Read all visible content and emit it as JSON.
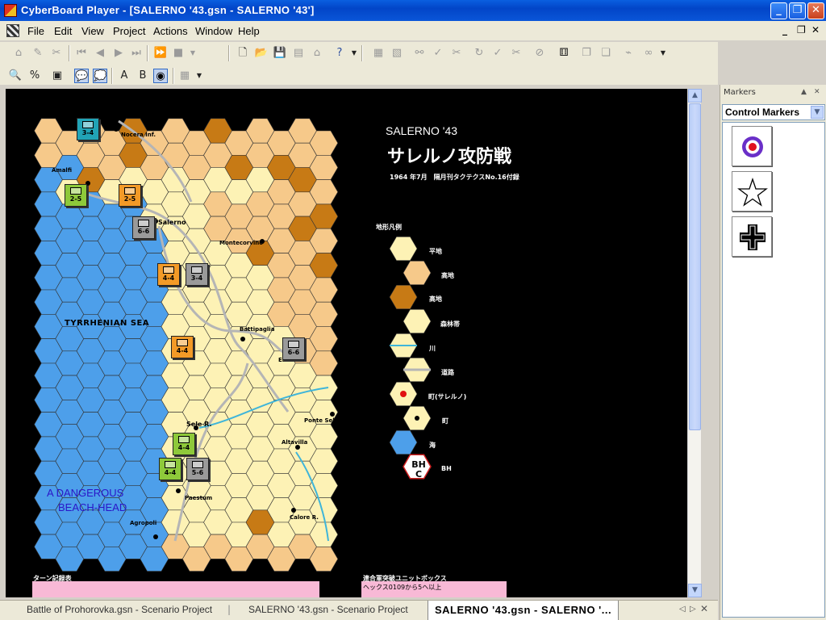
{
  "window": {
    "title": "CyberBoard Player - [SALERNO '43.gsn - SALERNO '43']",
    "min_glyph": "_",
    "max_glyph": "❐",
    "close_glyph": "✕"
  },
  "menu": {
    "items": [
      "File",
      "Edit",
      "View",
      "Project",
      "Actions",
      "Window",
      "Help"
    ],
    "mdi_min": "_",
    "mdi_restore": "❐",
    "mdi_close": "✕"
  },
  "board": {
    "game_title": "SALERNO '43",
    "game_title_jp": "サレルノ攻防戦",
    "subtitle": "1964 年7月　隔月刊タクテクスNo.16付録",
    "legend_title": "地形凡例",
    "legend_items": [
      "平地",
      "高地",
      "高地",
      "森林帯",
      "川",
      "道路",
      "町(サレルノ)",
      "町",
      "海",
      "BH"
    ],
    "legend_bh_line1": "BH",
    "legend_bh_line2": "C",
    "sea_label": "TYRRHENIAN SEA",
    "beach_line1": "A DANGEROUS",
    "beach_line2": "BEACH-HEAD",
    "towns": [
      "Nocera Inf.",
      "Amalfi",
      "Salerno",
      "Montecorvino",
      "Battipaglia",
      "Eboli",
      "Sele R.",
      "Ponte Sele",
      "Altavilla",
      "Paestum",
      "Calore R.",
      "Agropoli"
    ],
    "turn_box_title": "ターン記録表",
    "allied_box_title": "連合軍突破ユニットボックス",
    "allied_box_note": "ヘックス0109から5ヘ以上"
  },
  "units": [
    {
      "label": "3-4",
      "color": "#21a3b6"
    },
    {
      "label": "2-5",
      "color": "#8ec93a"
    },
    {
      "label": "2-5",
      "color": "#f39a27"
    },
    {
      "label": "6-6",
      "color": "#9a9a9a"
    },
    {
      "label": "4-4",
      "color": "#f39a27"
    },
    {
      "label": "3-4",
      "color": "#9a9a9a"
    },
    {
      "label": "4-4",
      "color": "#f39a27"
    },
    {
      "label": "6-6",
      "color": "#9a9a9a"
    },
    {
      "label": "4-4",
      "color": "#8ec93a"
    },
    {
      "label": "4-4",
      "color": "#8ec93a"
    },
    {
      "label": "5-6",
      "color": "#9a9a9a"
    }
  ],
  "markers_panel": {
    "caption": "Markers",
    "selected_group": "Control Markers",
    "markers": [
      "roundel-marker",
      "star-marker",
      "iron-cross-marker"
    ]
  },
  "tabs": [
    "Battle of Prohorovka.gsn - Scenario Project",
    "SALERNO '43.gsn - Scenario Project",
    "SALERNO '43.gsn - SALERNO '..."
  ],
  "colors": {
    "sea": "#4d9fea",
    "plain": "#fdf2b5",
    "hill": "#f6c98a",
    "mountain": "#c77a15",
    "board_bg": "#000000"
  }
}
